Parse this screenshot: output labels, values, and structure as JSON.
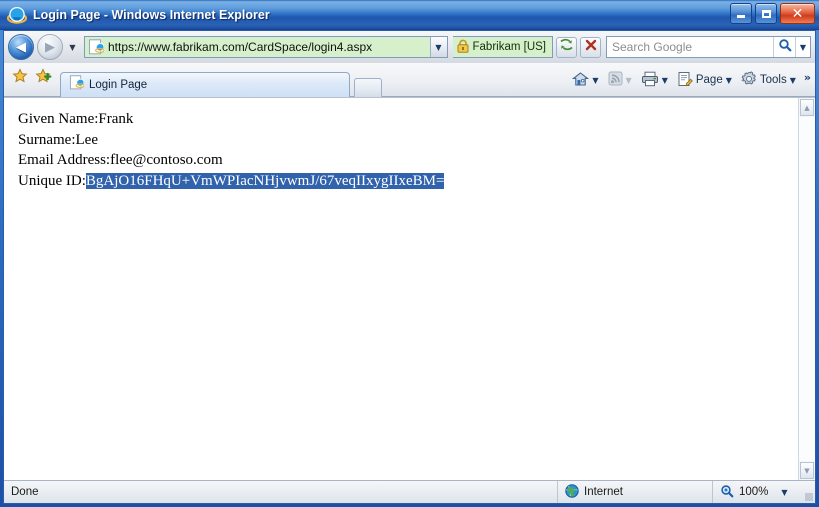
{
  "window": {
    "title": "Login Page - Windows Internet Explorer",
    "app_icon": "internet-explorer-logo-icon",
    "controls": {
      "minimize_label": "–",
      "maximize_label": "",
      "close_label": "✕"
    }
  },
  "navbar": {
    "back_label": "◀",
    "forward_label": "▶",
    "history_caret": "▼",
    "address": {
      "favicon": "internet-explorer-page-icon",
      "url": "https://www.fabrikam.com/CardSpace/login4.aspx",
      "dropdown_caret": "▼",
      "background_color": "#d5f0ca"
    },
    "ev_badge": {
      "lock_icon": "padlock-icon",
      "text": "Fabrikam [US]",
      "background_color": "#d5f0ca"
    },
    "refresh_icon": "refresh-icon",
    "stop_icon": "stop-x-icon",
    "search": {
      "placeholder": "Search Google",
      "value": "",
      "go_icon": "magnifier-icon",
      "caret": "▼"
    }
  },
  "tabbar": {
    "favorites_icon": "star-icon",
    "add_favorite_icon": "star-plus-icon",
    "tab": {
      "favicon": "internet-explorer-page-icon",
      "label": "Login Page"
    },
    "new_tab_label": "",
    "commands": [
      {
        "name": "home",
        "icon": "home-icon",
        "label": "",
        "caret": "▼",
        "dim": false
      },
      {
        "name": "feeds",
        "icon": "rss-feed-icon",
        "label": "",
        "caret": "▼",
        "dim": true
      },
      {
        "name": "print",
        "icon": "printer-icon",
        "label": "",
        "caret": "▼",
        "dim": false
      },
      {
        "name": "page",
        "icon": "page-document-icon",
        "label": "Page",
        "caret": "▼",
        "dim": false
      },
      {
        "name": "tools",
        "icon": "gear-icon",
        "label": "Tools",
        "caret": "▼",
        "dim": false
      }
    ],
    "overflow_label": "»"
  },
  "page_content": {
    "lines": [
      {
        "label": "Given Name:",
        "value": "Frank",
        "selected": false
      },
      {
        "label": "Surname:",
        "value": "Lee",
        "selected": false
      },
      {
        "label": "Email Address:",
        "value": "flee@contoso.com",
        "selected": false
      },
      {
        "label": "Unique ID:",
        "value": "BgAjO16FHqU+VmWPIacNHjvwmJ/67veqIIxygIIxeBM=",
        "selected": true
      }
    ],
    "selection_color": "#3163ac"
  },
  "scrollbar": {
    "up_arrow": "▲",
    "down_arrow": "▼"
  },
  "statusbar": {
    "status_text": "Done",
    "zone_icon": "globe-icon",
    "zone_text": "Internet",
    "zoom_icon": "magnifier-zoom-icon",
    "zoom_level": "100%",
    "zoom_caret": "▼"
  }
}
